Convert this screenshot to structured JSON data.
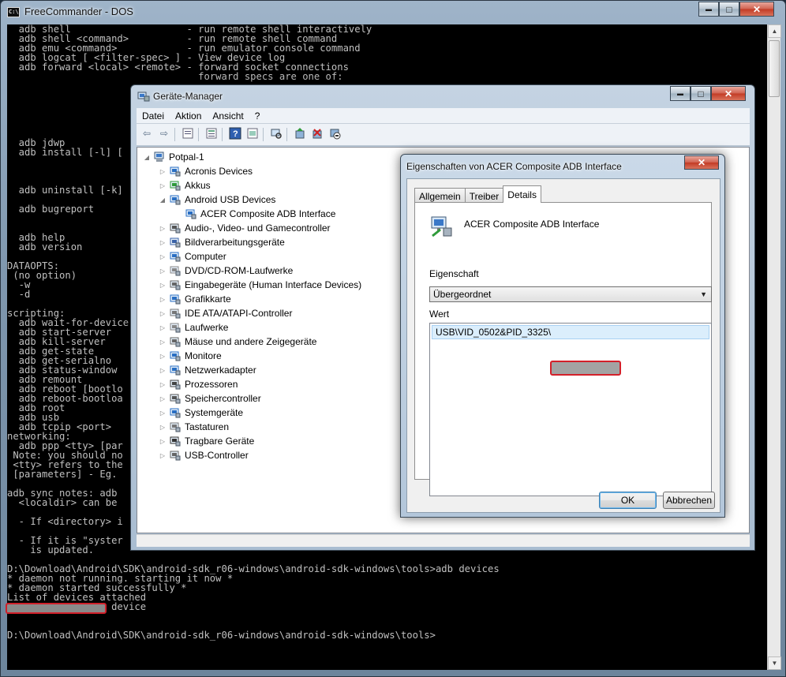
{
  "console": {
    "title": "FreeCommander - DOS",
    "icon_text": "C:\\",
    "lines": [
      "  adb shell                    - run remote shell interactively",
      "  adb shell <command>          - run remote shell command",
      "  adb emu <command>            - run emulator console command",
      "  adb logcat [ <filter-spec> ] - View device log",
      "  adb forward <local> <remote> - forward socket connections",
      "                                 forward specs are one of:",
      "",
      "",
      "",
      "",
      "",
      "",
      "  adb jdwp",
      "  adb install [-l] [",
      "",
      "",
      "",
      "  adb uninstall [-k]",
      "",
      "  adb bugreport",
      "",
      "",
      "  adb help",
      "  adb version",
      "",
      "DATAOPTS:",
      " (no option)",
      "  -w",
      "  -d",
      "",
      "scripting:",
      "  adb wait-for-device",
      "  adb start-server",
      "  adb kill-server",
      "  adb get-state",
      "  adb get-serialno",
      "  adb status-window",
      "  adb remount",
      "  adb reboot [bootlo",
      "  adb reboot-bootloa",
      "  adb root",
      "  adb usb",
      "  adb tcpip <port>",
      "networking:",
      "  adb ppp <tty> [par",
      " Note: you should no",
      " <tty> refers to the",
      " [parameters] - Eg.",
      "",
      "adb sync notes: adb",
      "  <localdir> can be",
      "",
      "  - If <directory> i",
      "",
      "  - If it is \"syster",
      "    is updated.",
      "",
      "D:\\Download\\Android\\SDK\\android-sdk_r06-windows\\android-sdk-windows\\tools>adb devices",
      "* daemon not running. starting it now *",
      "* daemon started successfully *",
      "List of devices attached",
      "                  device",
      "",
      "",
      "D:\\Download\\Android\\SDK\\android-sdk_r06-windows\\android-sdk-windows\\tools>"
    ],
    "scroll_up": "▲",
    "scroll_down": "▼"
  },
  "caption_buttons": {
    "minimize": "▬",
    "maximize": "□",
    "close": "✕"
  },
  "device_manager": {
    "title": "Geräte-Manager",
    "menu": [
      "Datei",
      "Aktion",
      "Ansicht",
      "?"
    ],
    "toolbar": [
      "back-icon",
      "forward-icon",
      "properties-icon",
      "details-view-icon",
      "help-icon",
      "show-hidden-icon",
      "scan-hardware-icon",
      "update-driver-icon",
      "uninstall-icon",
      "disable-icon"
    ],
    "tree": {
      "root": "Potpal-1",
      "categories": [
        {
          "label": "Acronis Devices",
          "icon": "acronis-icon",
          "color": "#2a6fc4"
        },
        {
          "label": "Akkus",
          "icon": "battery-icon",
          "color": "#2f9b3a"
        },
        {
          "label": "Android USB Devices",
          "icon": "android-usb-icon",
          "color": "#2a6fc4",
          "expanded": true,
          "children": [
            {
              "label": "ACER Composite ADB Interface",
              "icon": "usb-device-icon"
            }
          ]
        },
        {
          "label": "Audio-, Video- und Gamecontroller",
          "icon": "speaker-icon",
          "color": "#555"
        },
        {
          "label": "Bildverarbeitungsgeräte",
          "icon": "camera-icon",
          "color": "#3a62a8"
        },
        {
          "label": "Computer",
          "icon": "computer-icon",
          "color": "#2a6fc4"
        },
        {
          "label": "DVD/CD-ROM-Laufwerke",
          "icon": "dvd-drive-icon",
          "color": "#888"
        },
        {
          "label": "Eingabegeräte (Human Interface Devices)",
          "icon": "hid-icon",
          "color": "#666"
        },
        {
          "label": "Grafikkarte",
          "icon": "display-adapter-icon",
          "color": "#2a6fc4"
        },
        {
          "label": "IDE ATA/ATAPI-Controller",
          "icon": "ide-controller-icon",
          "color": "#777"
        },
        {
          "label": "Laufwerke",
          "icon": "disk-drive-icon",
          "color": "#888"
        },
        {
          "label": "Mäuse und andere Zeigegeräte",
          "icon": "mouse-icon",
          "color": "#666"
        },
        {
          "label": "Monitore",
          "icon": "monitor-icon",
          "color": "#2a6fc4"
        },
        {
          "label": "Netzwerkadapter",
          "icon": "network-adapter-icon",
          "color": "#2a6fc4"
        },
        {
          "label": "Prozessoren",
          "icon": "processor-icon",
          "color": "#444"
        },
        {
          "label": "Speichercontroller",
          "icon": "storage-controller-icon",
          "color": "#555"
        },
        {
          "label": "Systemgeräte",
          "icon": "system-device-icon",
          "color": "#2a6fc4"
        },
        {
          "label": "Tastaturen",
          "icon": "keyboard-icon",
          "color": "#777"
        },
        {
          "label": "Tragbare Geräte",
          "icon": "portable-device-icon",
          "color": "#333"
        },
        {
          "label": "USB-Controller",
          "icon": "usb-controller-icon",
          "color": "#666"
        }
      ]
    }
  },
  "properties_dialog": {
    "title": "Eigenschaften von ACER Composite ADB Interface",
    "tabs": [
      "Allgemein",
      "Treiber",
      "Details"
    ],
    "active_tab": "Details",
    "device_name": "ACER Composite ADB Interface",
    "property_label": "Eigenschaft",
    "property_value": "Übergeordnet",
    "value_label": "Wert",
    "value_text": "USB\\VID_0502&PID_3325\\",
    "ok_label": "OK",
    "cancel_label": "Abbrechen"
  }
}
